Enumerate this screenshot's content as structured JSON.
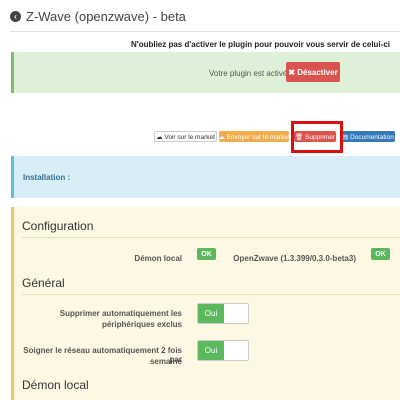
{
  "header": {
    "title": "Z-Wave (openzwave) - beta"
  },
  "notice": "N'oubliez pas d'activer le plugin pour pouvoir vous servir de celui-ci",
  "activation": {
    "status_text": "Votre plugin est activé.",
    "deactivate_label": "✖ Désactiver"
  },
  "actions": {
    "market_label": "☁ Voir sur le market",
    "send_label": "☁ Envoyer sur le market",
    "delete_label": "🗑 Supprimer",
    "doc_label": "▤ Documentation"
  },
  "installation": {
    "label": "Installation :"
  },
  "configuration": {
    "title": "Configuration",
    "daemon_label": "Démon local",
    "daemon_status": "OK",
    "openzwave_label": "OpenZwave (1.3.399/0.3.0-beta3)",
    "openzwave_status": "OK"
  },
  "general": {
    "title": "Général",
    "auto_delete_label_line1": "Supprimer automatiquement les",
    "auto_delete_label_line2": "périphériques exclus",
    "auto_delete_value": "Oui",
    "auto_heal_label_line1": "Soigner le réseau automatiquement 2 fois par",
    "auto_heal_label_line2": "semaine",
    "auto_heal_value": "Oui"
  },
  "daemon_section": {
    "title": "Démon local"
  },
  "colors": {
    "success": "#5cb85c",
    "danger": "#d9534f",
    "warning": "#f0ad4e",
    "primary": "#337ab7",
    "highlight": "#d8110f"
  }
}
